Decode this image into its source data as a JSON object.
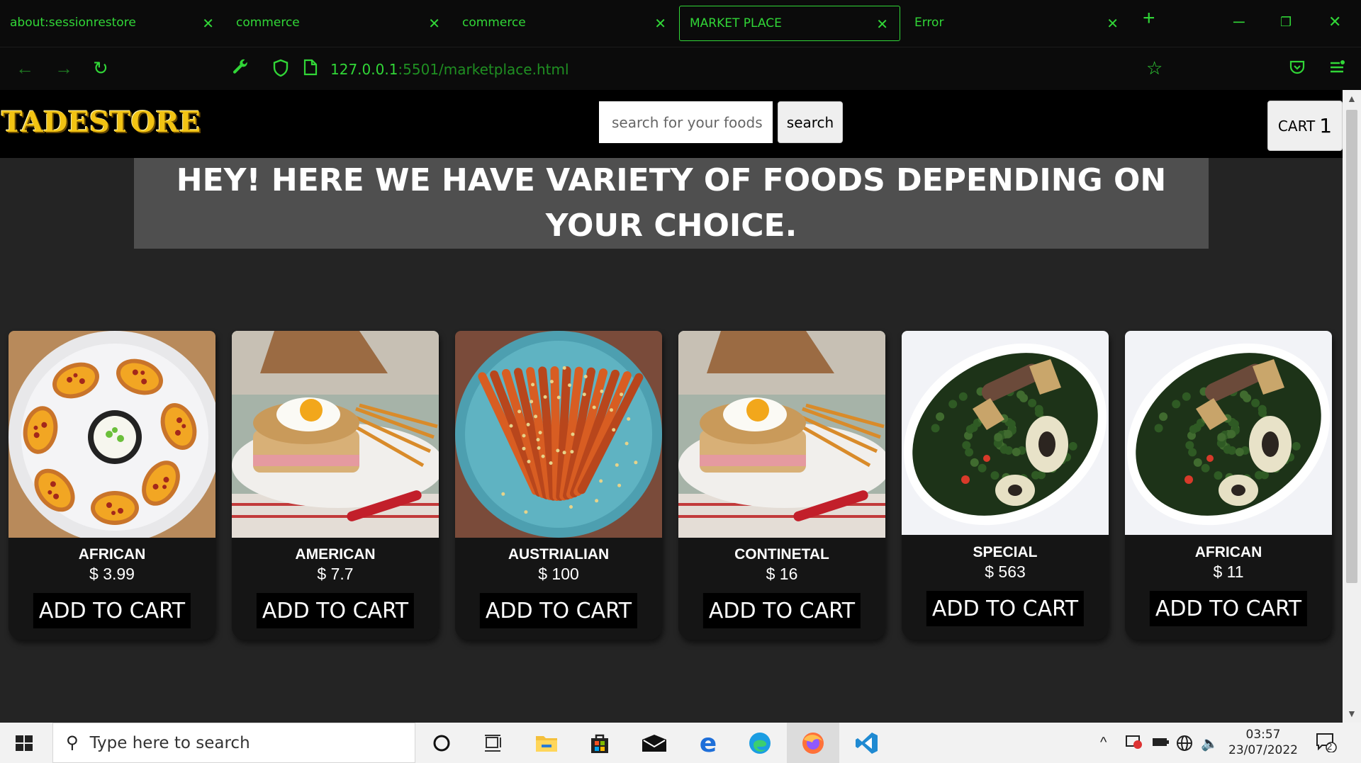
{
  "browser": {
    "tabs": [
      {
        "label": "about:sessionrestore",
        "active": false
      },
      {
        "label": "commerce",
        "active": false
      },
      {
        "label": "commerce",
        "active": false
      },
      {
        "label": "MARKET PLACE",
        "active": true
      },
      {
        "label": "Error",
        "active": false
      }
    ],
    "url_host": "127.0.0.1",
    "url_rest": ":5501/marketplace.html",
    "accent_color": "#31d637"
  },
  "site": {
    "logo": "TADESTORE",
    "search_placeholder": "search for your foods",
    "search_button": "search",
    "cart_label": "CART",
    "cart_count": "1",
    "hero_text": "HEY! HERE WE HAVE VARIETY OF FOODS DEPENDING ON YOUR CHOICE."
  },
  "products": [
    {
      "name": "AFRICAN",
      "price": "$ 3.99",
      "button": "ADD TO CART",
      "image": "potato-skins"
    },
    {
      "name": "AMERICAN",
      "price": "$ 7.7",
      "button": "ADD TO CART",
      "image": "croque-madame"
    },
    {
      "name": "AUSTRIALIAN",
      "price": "$ 100",
      "button": "ADD TO CART",
      "image": "roasted-carrots"
    },
    {
      "name": "CONTINETAL",
      "price": "$ 16",
      "button": "ADD TO CART",
      "image": "croque-madame"
    },
    {
      "name": "SPECIAL",
      "price": "$ 563",
      "button": "ADD TO CART",
      "image": "efo-riro"
    },
    {
      "name": "AFRICAN",
      "price": "$ 11",
      "button": "ADD TO CART",
      "image": "efo-riro"
    }
  ],
  "taskbar": {
    "search_placeholder": "Type here to search",
    "time": "03:57",
    "date": "23/07/2022",
    "notification_count": "2"
  }
}
